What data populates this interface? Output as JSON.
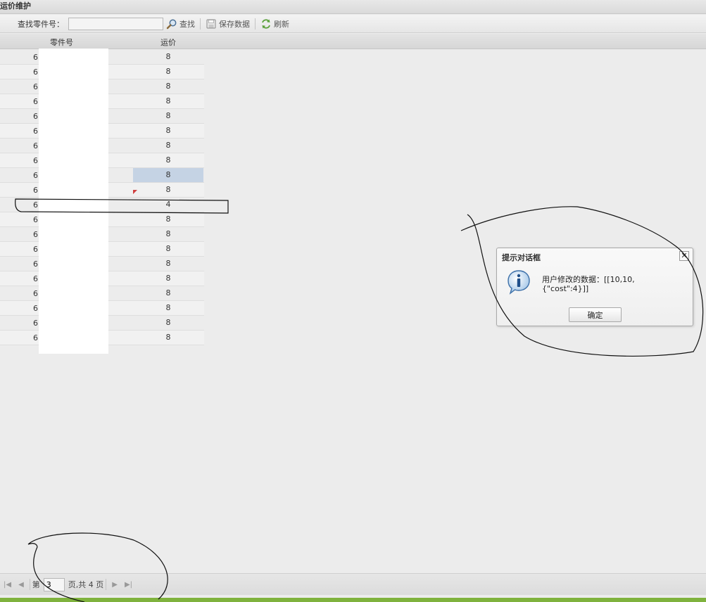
{
  "window": {
    "title": "运价维护"
  },
  "toolbar": {
    "search_label": "查找零件号：",
    "search_value": "",
    "search_button": "查找",
    "save_button": "保存数据",
    "refresh_button": "刷新"
  },
  "grid": {
    "columns": [
      "零件号",
      "运价"
    ],
    "rows": [
      {
        "id": "6",
        "cost": "8"
      },
      {
        "id": "6",
        "cost": "8"
      },
      {
        "id": "6",
        "cost": "8"
      },
      {
        "id": "6",
        "cost": "8"
      },
      {
        "id": "6",
        "cost": "8"
      },
      {
        "id": "6",
        "cost": "8"
      },
      {
        "id": "6",
        "cost": "8"
      },
      {
        "id": "6",
        "cost": "8"
      },
      {
        "id": "6",
        "cost": "8"
      },
      {
        "id": "6",
        "cost": "8"
      },
      {
        "id": "6",
        "cost": "4"
      },
      {
        "id": "6",
        "cost": "8"
      },
      {
        "id": "6",
        "cost": "8"
      },
      {
        "id": "6",
        "cost": "8"
      },
      {
        "id": "6",
        "cost": "8"
      },
      {
        "id": "6",
        "cost": "8"
      },
      {
        "id": "6",
        "cost": "8"
      },
      {
        "id": "6",
        "cost": "8"
      },
      {
        "id": "6",
        "cost": "8"
      },
      {
        "id": "6",
        "cost": "8"
      }
    ]
  },
  "dialog": {
    "title": "提示对话框",
    "message_line1": "用户修改的数据：[[10,10,",
    "message_line2": "{\"cost\":4}]]",
    "ok_button": "确定",
    "close_glyph": "✕"
  },
  "pager": {
    "prefix": "第",
    "current_page": "3",
    "suffix": "页,共 4 页"
  },
  "colors": {
    "selected_cell": "#c5d3e4",
    "dirty_marker": "#d04040",
    "status_bar": "#7fb23d"
  }
}
